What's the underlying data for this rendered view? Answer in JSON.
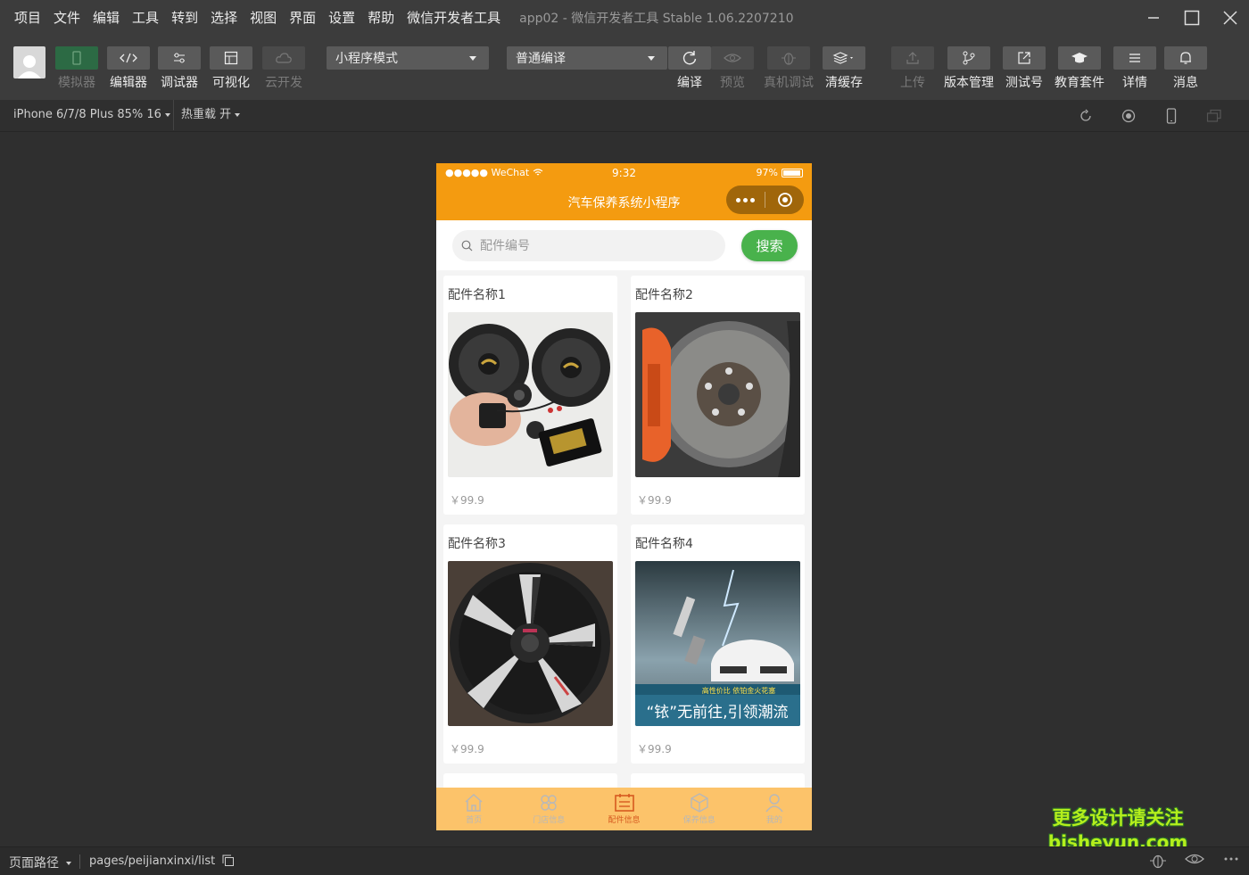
{
  "menu": {
    "items": [
      "项目",
      "文件",
      "编辑",
      "工具",
      "转到",
      "选择",
      "视图",
      "界面",
      "设置",
      "帮助",
      "微信开发者工具"
    ],
    "app_title": "app02 - 微信开发者工具 Stable 1.06.2207210"
  },
  "toolbar": {
    "left_tools": [
      {
        "label": "模拟器",
        "icon": "phone-icon",
        "state": "active-disabled"
      },
      {
        "label": "编辑器",
        "icon": "code-icon"
      },
      {
        "label": "调试器",
        "icon": "debug-sliders-icon"
      },
      {
        "label": "可视化",
        "icon": "layout-icon"
      },
      {
        "label": "云开发",
        "icon": "cloud-icon",
        "state": "disabled"
      }
    ],
    "mode_select": "小程序模式",
    "compile_select": "普通编译",
    "mid_tools": [
      {
        "label": "编译",
        "icon": "refresh-icon"
      },
      {
        "label": "预览",
        "icon": "eye-icon",
        "state": "disabled"
      },
      {
        "label": "真机调试",
        "icon": "bug-icon",
        "state": "disabled"
      },
      {
        "label": "清缓存",
        "icon": "layers-icon"
      }
    ],
    "right_tools": [
      {
        "label": "上传",
        "icon": "upload-icon",
        "state": "disabled"
      },
      {
        "label": "版本管理",
        "icon": "branch-icon"
      },
      {
        "label": "测试号",
        "icon": "external-link-icon"
      },
      {
        "label": "教育套件",
        "icon": "graduation-cap-icon"
      },
      {
        "label": "详情",
        "icon": "menu-lines-icon"
      },
      {
        "label": "消息",
        "icon": "bell-icon"
      }
    ]
  },
  "subbar": {
    "device": "iPhone 6/7/8 Plus 85% 16",
    "hot_reload": "热重载 开"
  },
  "simulator": {
    "status": {
      "carrier": "●●●●● WeChat",
      "time": "9:32",
      "battery": "97%",
      "battery_level": 0.97
    },
    "nav_title": "汽车保养系统小程序",
    "search": {
      "placeholder": "配件编号",
      "button": "搜索"
    },
    "cards": [
      {
        "title": "配件名称1",
        "price": "￥99.9",
        "image": "speakers-photo"
      },
      {
        "title": "配件名称2",
        "price": "￥99.9",
        "image": "brake-caliper-photo"
      },
      {
        "title": "配件名称3",
        "price": "￥99.9",
        "image": "alloy-wheel-photo"
      },
      {
        "title": "配件名称4",
        "price": "￥99.9",
        "image": "spark-plug-ad-photo",
        "overlay_text": "高性价比 依铂金火花塞",
        "overlay_text2": "“铱”无前往,引领潮流"
      }
    ],
    "tabs": [
      {
        "label": "首页",
        "icon": "home-icon"
      },
      {
        "label": "门店信息",
        "icon": "store-icon"
      },
      {
        "label": "配件信息",
        "icon": "parts-icon",
        "active": true
      },
      {
        "label": "保养信息",
        "icon": "box-icon"
      },
      {
        "label": "我的",
        "icon": "user-icon"
      }
    ],
    "colors": {
      "navbar": "#f49b10",
      "tabbar": "#fcc36a",
      "search_button": "#49b24c",
      "active_tab": "#d65a20"
    }
  },
  "watermark": {
    "line1": "更多设计请关注",
    "line2": "bisheyun.com"
  },
  "bottombar": {
    "label": "页面路径",
    "path": "pages/peijianxinxi/list"
  }
}
